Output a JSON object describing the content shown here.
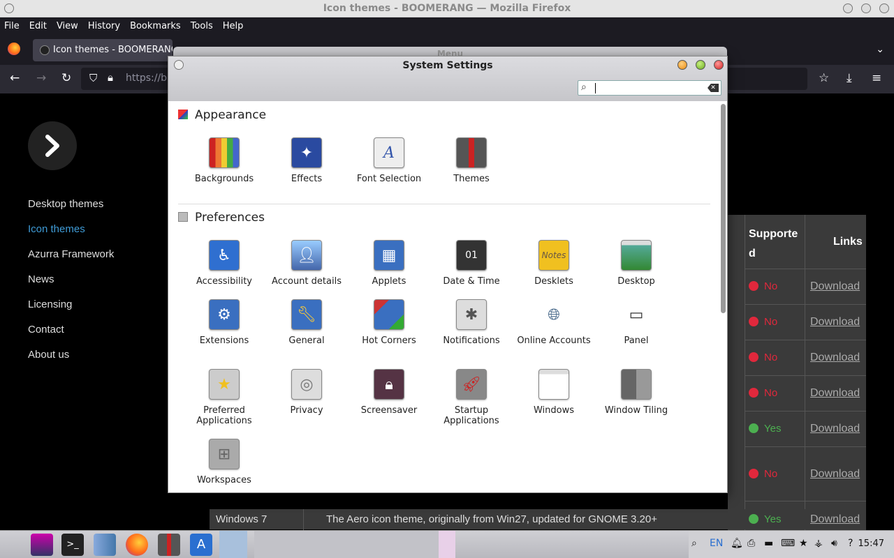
{
  "window": {
    "title": "Icon themes - BOOMERANG — Mozilla Firefox"
  },
  "menubar": [
    "File",
    "Edit",
    "View",
    "History",
    "Bookmarks",
    "Tools",
    "Help"
  ],
  "tab": {
    "label": "Icon themes - BOOMERANG"
  },
  "url": {
    "text": "https://b0"
  },
  "site_nav": {
    "items": [
      {
        "label": "Desktop themes"
      },
      {
        "label": "Icon themes"
      },
      {
        "label": "Azurra Framework"
      },
      {
        "label": "News"
      },
      {
        "label": "Licensing"
      },
      {
        "label": "Contact"
      },
      {
        "label": "About us"
      }
    ]
  },
  "table": {
    "headers": {
      "supported": "Supporte d",
      "links": "Links"
    },
    "rows": [
      {
        "supported": "No",
        "link": "Download",
        "status_color": "#e0283c"
      },
      {
        "supported": "No",
        "link": "Download",
        "status_color": "#e0283c"
      },
      {
        "supported": "No",
        "link": "Download",
        "status_color": "#e0283c"
      },
      {
        "supported": "No",
        "link": "Download",
        "status_color": "#e0283c"
      },
      {
        "supported": "Yes",
        "link": "Download",
        "status_color": "#4caf50"
      },
      {
        "supported": "No",
        "link": "Download",
        "status_color": "#e0283c"
      },
      {
        "supported": "Yes",
        "link": "Download",
        "status_color": "#4caf50"
      }
    ],
    "last_row": {
      "name": "Windows 7",
      "description": "The Aero icon theme, originally from Win27, updated for GNOME 3.20+"
    }
  },
  "ghost_window": {
    "title": "Menu"
  },
  "dialog": {
    "title": "System Settings",
    "search": {
      "value": ""
    },
    "sections": {
      "appearance": {
        "title": "Appearance",
        "items": [
          "Backgrounds",
          "Effects",
          "Font Selection",
          "Themes"
        ]
      },
      "preferences": {
        "title": "Preferences",
        "items": [
          "Accessibility",
          "Account details",
          "Applets",
          "Date & Time",
          "Desklets",
          "Desktop",
          "Extensions",
          "General",
          "Hot Corners",
          "Notifications",
          "Online Accounts",
          "Panel",
          "Preferred Applications",
          "Privacy",
          "Screensaver",
          "Startup Applications",
          "Windows",
          "Window Tiling",
          "Workspaces"
        ]
      }
    }
  },
  "taskbar": {
    "lang": "EN",
    "clock": "15:47"
  }
}
